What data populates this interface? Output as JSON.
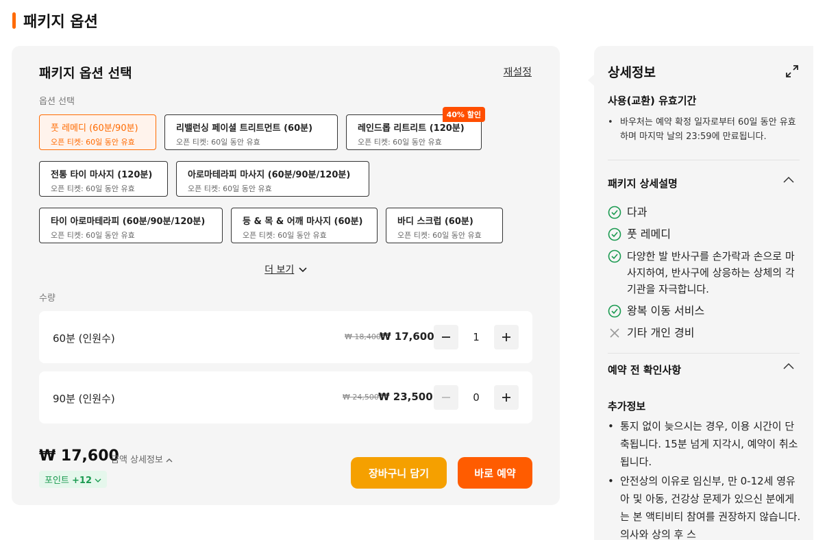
{
  "page": {
    "title": "패키지 옵션"
  },
  "panel": {
    "title": "패키지 옵션 선택",
    "reset_label": "재설정",
    "options_label": "옵션 선택",
    "options": [
      {
        "name": "풋 레메디 (60분/90분)",
        "sub": "오픈 티켓: 60일 동안 유효",
        "selected": true
      },
      {
        "name": "리밸런싱 페이셜 트리트먼트 (60분)",
        "sub": "오픈 티켓: 60일 동안 유효"
      },
      {
        "name": "레인드롭 리트리트 (120분)",
        "sub": "오픈 티켓: 60일 동안 유효",
        "badge": "40% 할인"
      },
      {
        "name": "전통 타이 마사지 (120분)",
        "sub": "오픈 티켓: 60일 동안 유효"
      },
      {
        "name": "아로마테라피 마사지 (60분/90분/120분)",
        "sub": "오픈 티켓: 60일 동안 유효"
      },
      {
        "name": "타이 아로마테라피 (60분/90분/120분)",
        "sub": "오픈 티켓: 60일 동안 유효"
      },
      {
        "name": "등 & 목 & 어깨 마사지 (60분)",
        "sub": "오픈 티켓: 60일 동안 유효"
      },
      {
        "name": "바디 스크럽 (60분)",
        "sub": "오픈 티켓: 60일 동안 유효"
      }
    ],
    "more_label": "더 보기",
    "quantity_label": "수량",
    "rows": [
      {
        "label": "60분 (인원수)",
        "original": "₩ 18,400",
        "price": "₩ 17,600",
        "qty": "1"
      },
      {
        "label": "90분 (인원수)",
        "original": "₩ 24,500",
        "price": "₩ 23,500",
        "qty": "0"
      }
    ],
    "total": "₩ 17,600",
    "price_detail_label": "금액 상세정보",
    "points_label": "포인트",
    "points_value": "+12",
    "cart_button": "장바구니 담기",
    "book_button": "바로 예약"
  },
  "side": {
    "title": "상세정보",
    "validity_title": "사용(교환) 유효기간",
    "validity_text": "바우처는 예약 확정 일자로부터 60일 동안 유효하며 마지막 날의 23:59에 만료됩니다.",
    "package_title": "패키지 상세설명",
    "included": [
      "다과",
      "풋 레메디",
      "다양한 발 반사구를 손가락과 손으로 마사지하여, 반사구에 상응하는 상체의 각 기관을 자극합니다.",
      "왕복 이동 서비스"
    ],
    "excluded": [
      "기타 개인 경비"
    ],
    "notice_title": "예약 전 확인사항",
    "extra_title": "추가정보",
    "extra_items": [
      "통지 없이 늦으시는 경우, 이용 시간이 단축됩니다. 15분 넘게 지각시, 예약이 취소됩니다.",
      "안전상의 이유로 임신부, 만 0-12세 영유아 및 아동, 건강상 문제가 있으신 분에게는 본 액티비티 참여를 권장하지 않습니다. 의사와 상의 후 스"
    ]
  },
  "colors": {
    "accent": "#ff6a00",
    "cart": "#f5a000",
    "book": "#ff5c00",
    "check": "#1a9a50"
  }
}
